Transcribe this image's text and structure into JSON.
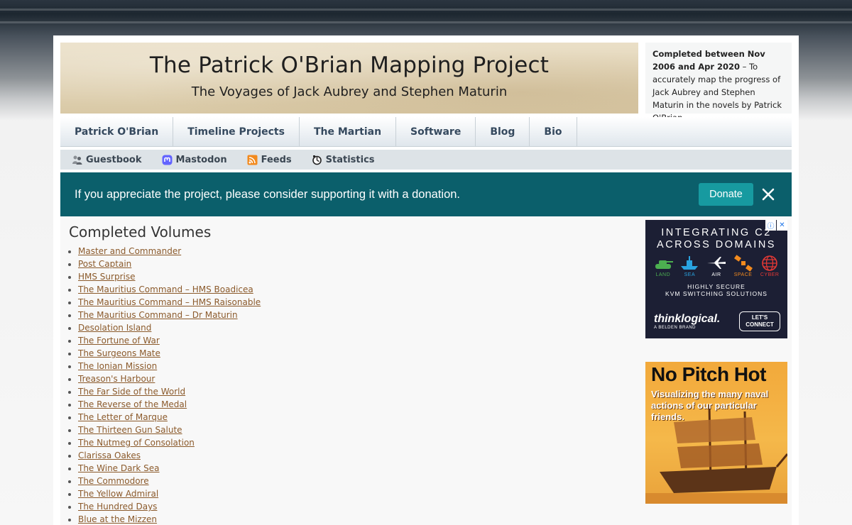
{
  "site": {
    "title": "The Patrick O'Brian Mapping Project",
    "subtitle": "The Voyages of Jack Aubrey and Stephen Maturin"
  },
  "intro": {
    "bold": "Completed between Nov 2006 and Apr 2020",
    "text": " – To accurately map the progress of Jack Aubrey and Stephen Maturin in the novels by Patrick O'Brian."
  },
  "main_nav": [
    {
      "label": "Patrick O'Brian"
    },
    {
      "label": "Timeline Projects"
    },
    {
      "label": "The Martian"
    },
    {
      "label": "Software"
    },
    {
      "label": "Blog"
    },
    {
      "label": "Bio"
    }
  ],
  "sub_nav": [
    {
      "label": "Guestbook",
      "icon": "guestbook-icon"
    },
    {
      "label": "Mastodon",
      "icon": "mastodon-icon"
    },
    {
      "label": "Feeds",
      "icon": "rss-feed-icon"
    },
    {
      "label": "Statistics",
      "icon": "statistics-icon"
    }
  ],
  "donation": {
    "message": "If you appreciate the project, please consider supporting it with a donation.",
    "button_label": "Donate",
    "close_icon": "close-icon"
  },
  "content": {
    "section_title": "Completed Volumes",
    "volumes": [
      "Master and Commander",
      "Post Captain",
      "HMS Surprise",
      "The Mauritius Command – HMS Boadicea",
      "The Mauritius Command – HMS Raisonable",
      "The Mauritius Command – Dr Maturin",
      "Desolation Island",
      "The Fortune of War",
      "The Surgeons Mate",
      "The Ionian Mission",
      "Treason's Harbour",
      "The Far Side of the World",
      "The Reverse of the Medal",
      "The Letter of Marque",
      "The Thirteen Gun Salute",
      "The Nutmeg of Consolation",
      "Clarissa Oakes",
      "The Wine Dark Sea",
      "The Commodore",
      "The Yellow Admiral",
      "The Hundred Days",
      "Blue at the Mizzen"
    ]
  },
  "ads": {
    "ad_one": {
      "headline_line1": "INTEGRATING C2",
      "headline_line2": "ACROSS DOMAINS",
      "domains": [
        "LAND",
        "SEA",
        "AIR",
        "SPACE",
        "CYBER"
      ],
      "tagline_line1": "HIGHLY SECURE",
      "tagline_line2": "KVM SWITCHING SOLUTIONS",
      "brand": "thinklogical.",
      "brand_sub": "A BELDEN BRAND",
      "cta": "LET'S CONNECT",
      "info_badge": "ⓘ",
      "close_badge": "✕"
    },
    "ad_two": {
      "title": "No Pitch Hot",
      "description": "Visualizing the many naval actions of our particular friends."
    }
  },
  "colors": {
    "banner": "#0b5f6b",
    "donate_button": "#179aa0",
    "link": "#8b5a2b",
    "nav_text": "#35495e"
  }
}
